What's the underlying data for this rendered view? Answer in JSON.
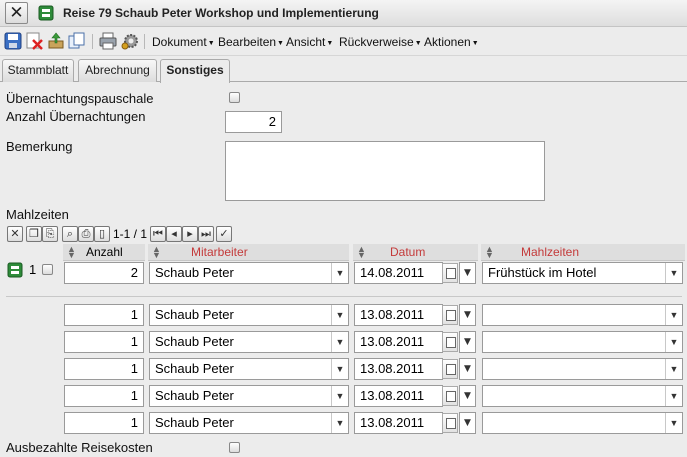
{
  "window": {
    "title": "Reise 79 Schaub Peter Workshop und Implementierung",
    "close_symbol": "✕",
    "icon": "sign-icon"
  },
  "toolbar": {
    "icons": [
      "save-icon",
      "delete-icon",
      "upload-icon",
      "copy-icon",
      "print-icon",
      "settings-icon"
    ],
    "menus": [
      "Dokument",
      "Bearbeiten",
      "Ansicht",
      "Rückverweise",
      "Aktionen"
    ]
  },
  "tabs": [
    "Stammblatt",
    "Abrechnung",
    "Sonstiges"
  ],
  "active_tab": "Sonstiges",
  "form": {
    "uebernachtungspauschale_label": "Übernachtungspauschale",
    "anzahl_uebernachtungen_label": "Anzahl Übernachtungen",
    "anzahl_uebernachtungen_value": "2",
    "bemerkung_label": "Bemerkung",
    "bemerkung_value": "",
    "ausbezahlte_label": "Ausbezahlte Reisekosten"
  },
  "mahlzeiten": {
    "label": "Mahlzeiten",
    "pager": "1-1 / 1",
    "columns": {
      "anzahl": "Anzahl",
      "mitarbeiter": "Mitarbeiter",
      "datum": "Datum",
      "mahlzeiten": "Mahlzeiten"
    },
    "row_number": "1",
    "rows": [
      {
        "anzahl": "2",
        "mitarbeiter": "Schaub Peter",
        "datum": "14.08.2011",
        "mahlzeiten": "Frühstück im Hotel"
      },
      {
        "anzahl": "1",
        "mitarbeiter": "Schaub Peter",
        "datum": "13.08.2011",
        "mahlzeiten": ""
      },
      {
        "anzahl": "1",
        "mitarbeiter": "Schaub Peter",
        "datum": "13.08.2011",
        "mahlzeiten": ""
      },
      {
        "anzahl": "1",
        "mitarbeiter": "Schaub Peter",
        "datum": "13.08.2011",
        "mahlzeiten": ""
      },
      {
        "anzahl": "1",
        "mitarbeiter": "Schaub Peter",
        "datum": "13.08.2011",
        "mahlzeiten": ""
      },
      {
        "anzahl": "1",
        "mitarbeiter": "Schaub Peter",
        "datum": "13.08.2011",
        "mahlzeiten": ""
      }
    ]
  },
  "colors": {
    "header_red": "#c43a3a",
    "sign_green": "#2e8b3a"
  }
}
